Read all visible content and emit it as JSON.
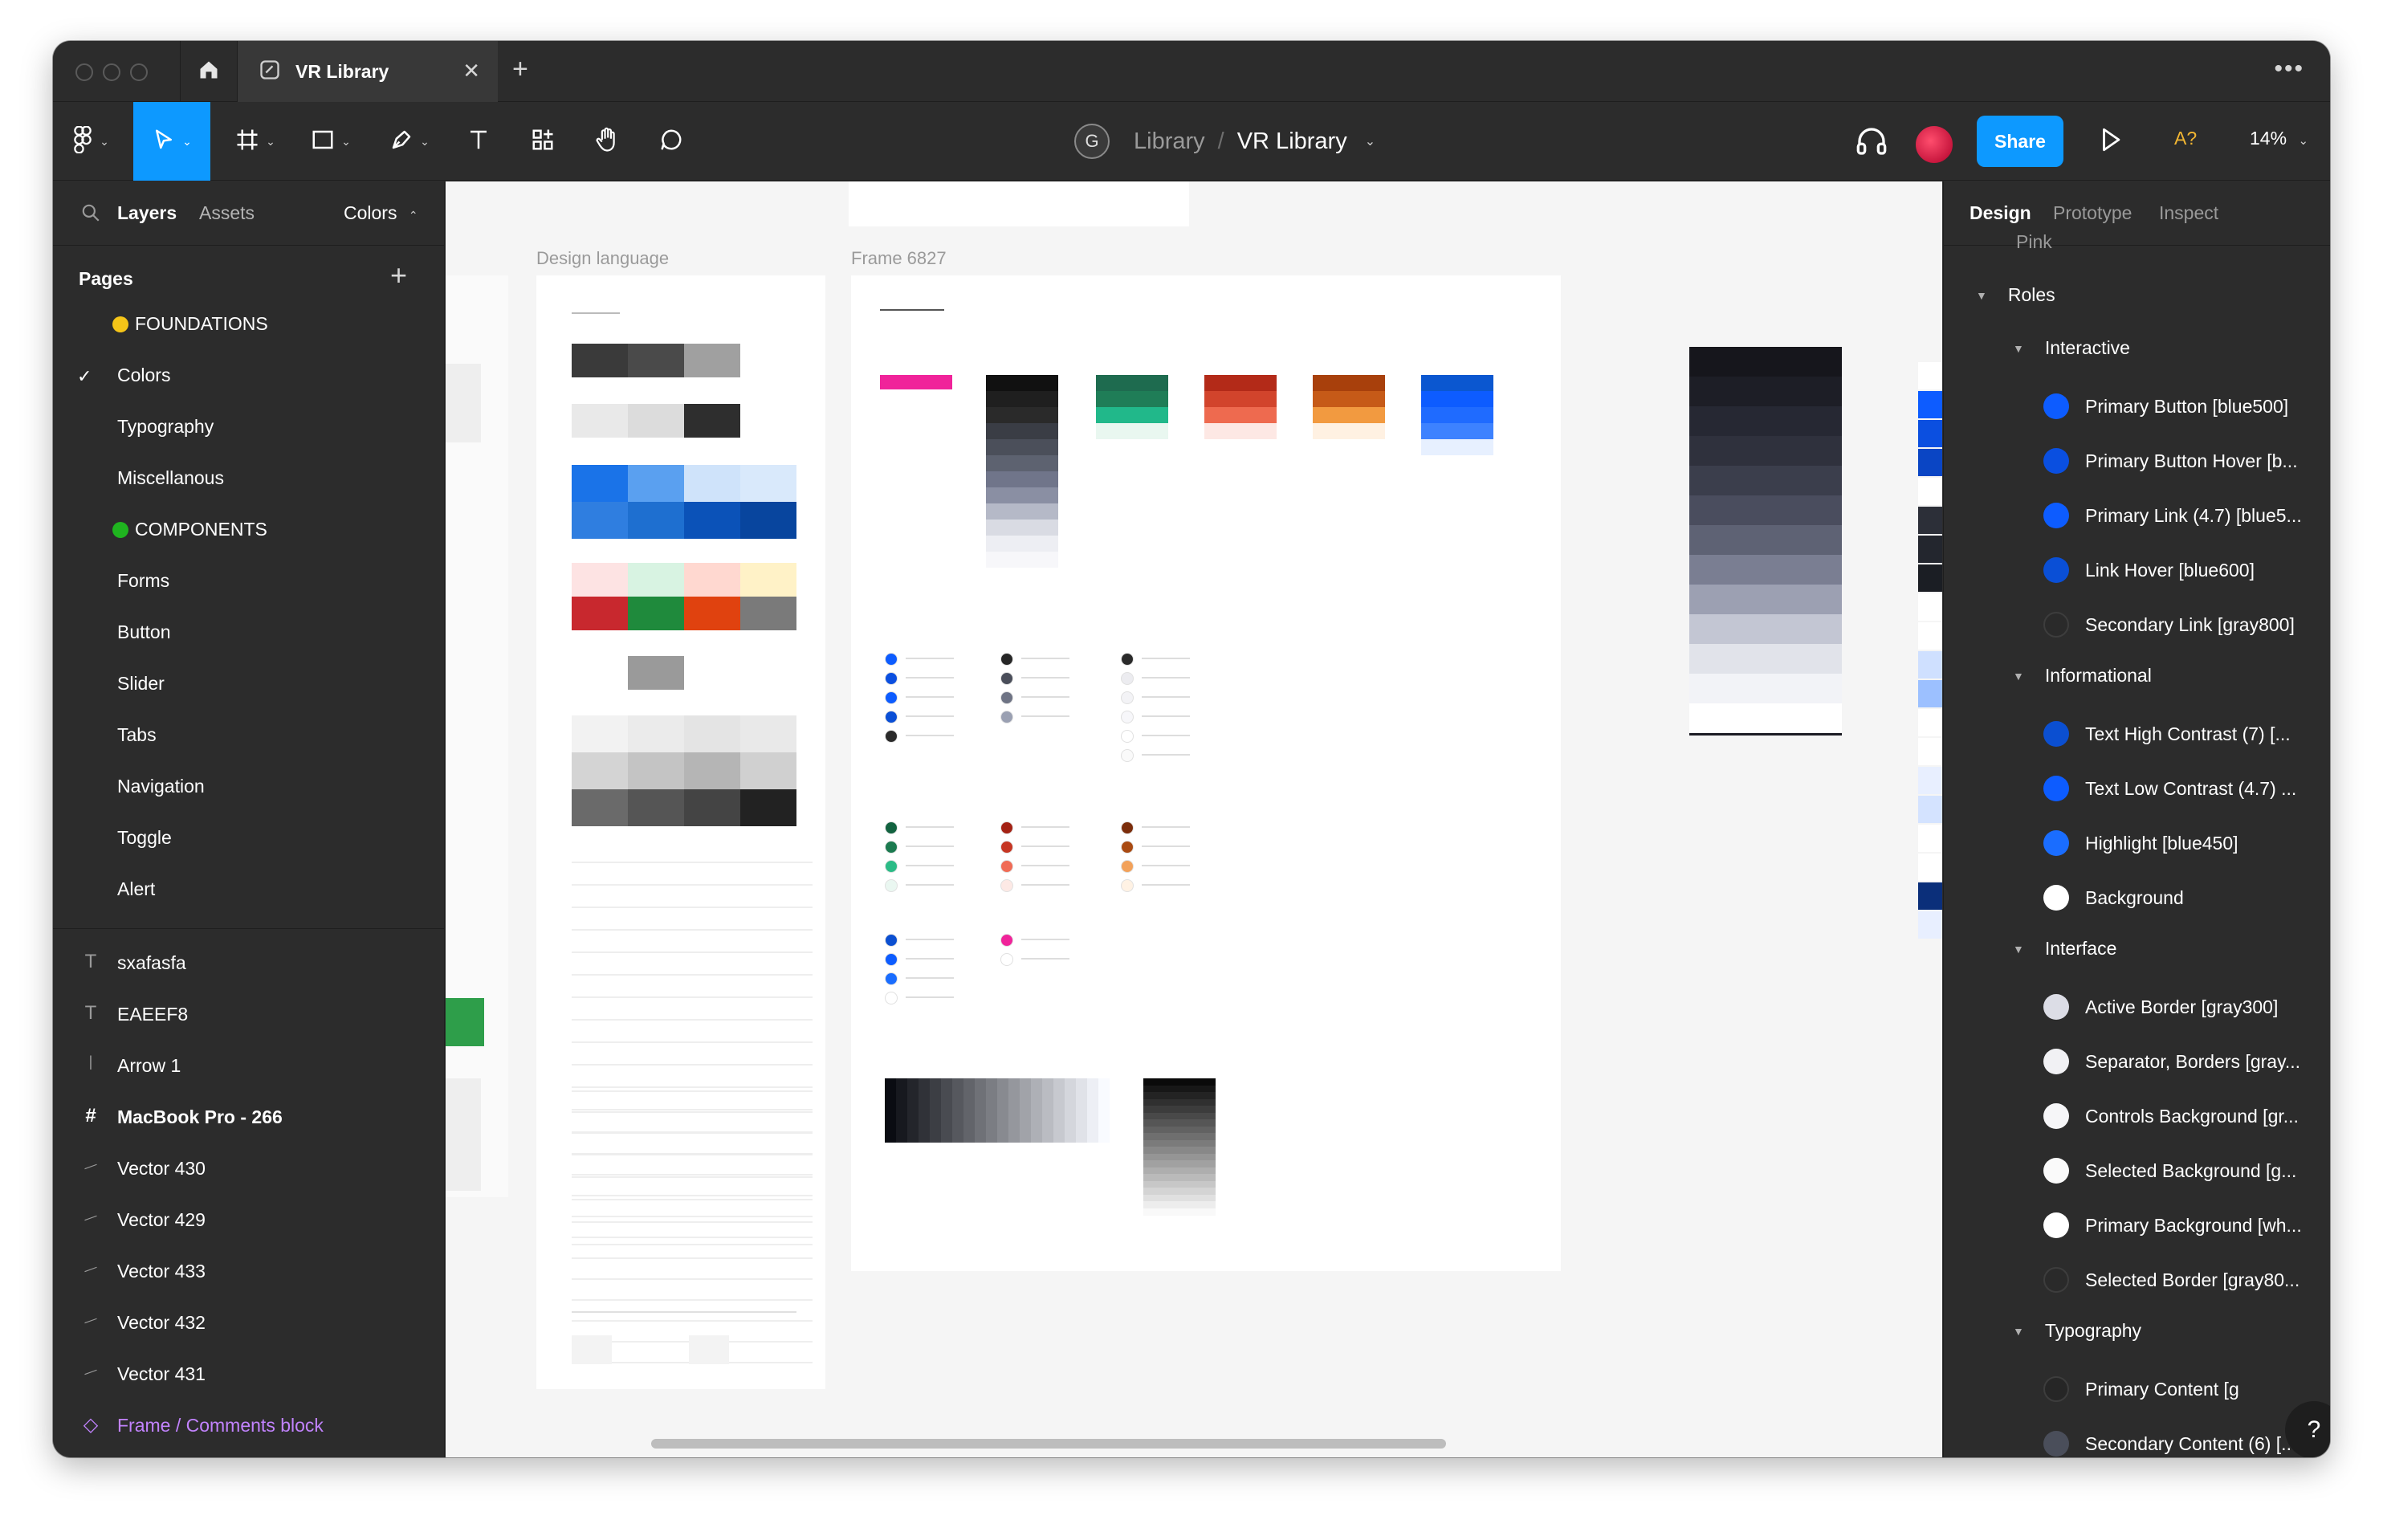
{
  "window": {
    "tab_title": "VR Library",
    "new_tab": "+",
    "close": "✕",
    "more": "•••"
  },
  "toolbar": {
    "user_initial": "G",
    "breadcrumb_project": "Library",
    "breadcrumb_sep": "/",
    "breadcrumb_file": "VR Library",
    "share_label": "Share",
    "a11y_label": "A?",
    "zoom": "14%"
  },
  "left_panel": {
    "tabs": [
      "Layers",
      "Assets"
    ],
    "page_selector": "Colors",
    "pages_header": "Pages",
    "pages": [
      {
        "label": "FOUNDATIONS",
        "dot": "#f5c518"
      },
      {
        "label": "Colors",
        "selected": true
      },
      {
        "label": "Typography"
      },
      {
        "label": "Miscellanous"
      },
      {
        "label": "COMPONENTS",
        "dot": "#1fb41f"
      },
      {
        "label": "Forms"
      },
      {
        "label": "Button"
      },
      {
        "label": "Slider"
      },
      {
        "label": "Tabs"
      },
      {
        "label": "Navigation"
      },
      {
        "label": "Toggle"
      },
      {
        "label": "Alert"
      }
    ],
    "layers": [
      {
        "label": "sxafasfa",
        "icon": "text-icon"
      },
      {
        "label": "EAEEF8",
        "icon": "text-icon"
      },
      {
        "label": "Arrow 1",
        "icon": "arrow-icon"
      },
      {
        "label": "MacBook Pro - 266",
        "icon": "frame-icon",
        "bold": true
      },
      {
        "label": "Vector 430",
        "icon": "vector-icon"
      },
      {
        "label": "Vector 429",
        "icon": "vector-icon"
      },
      {
        "label": "Vector 433",
        "icon": "vector-icon"
      },
      {
        "label": "Vector 432",
        "icon": "vector-icon"
      },
      {
        "label": "Vector 431",
        "icon": "vector-icon"
      },
      {
        "label": "Frame / Comments block",
        "icon": "component-icon",
        "accent": "#c283ff"
      }
    ]
  },
  "canvas": {
    "frame_labels": [
      "Design language",
      "Frame 6827"
    ]
  },
  "right_panel": {
    "tabs": [
      "Design",
      "Prototype",
      "Inspect"
    ],
    "truncated_top": "Pink",
    "roles_header": "Roles",
    "groups": [
      {
        "label": "Interactive",
        "items": [
          {
            "label": "Primary Button [blue500]",
            "color": "#0d5cff"
          },
          {
            "label": "Primary Button Hover [b...",
            "color": "#0a4fe0"
          },
          {
            "label": "Primary Link (4.7) [blue5...",
            "color": "#0d5cff"
          },
          {
            "label": "Link Hover [blue600]",
            "color": "#0a4fd6"
          },
          {
            "label": "Secondary Link [gray800]",
            "color": "#2a2a2a"
          }
        ]
      },
      {
        "label": "Informational",
        "items": [
          {
            "label": "Text High Contrast (7) [...",
            "color": "#0b4fd1"
          },
          {
            "label": "Text Low Contrast (4.7) ...",
            "color": "#0d5cff"
          },
          {
            "label": "Highlight [blue450]",
            "color": "#1a6dff"
          },
          {
            "label": "Background",
            "color": "#ffffff"
          }
        ]
      },
      {
        "label": "Interface",
        "items": [
          {
            "label": "Active Border [gray300]",
            "color": "#dcdde6"
          },
          {
            "label": "Separator, Borders [gray...",
            "color": "#f1f1f4"
          },
          {
            "label": "Controls Background [gr...",
            "color": "#f6f6f8"
          },
          {
            "label": "Selected Background [g...",
            "color": "#fafafa"
          },
          {
            "label": "Primary Background [wh...",
            "color": "#ffffff"
          },
          {
            "label": "Selected Border [gray80...",
            "color": "#2a2a2a"
          }
        ]
      },
      {
        "label": "Typography",
        "items": [
          {
            "label": "Primary Content [g",
            "color": "#262626"
          },
          {
            "label": "Secondary Content (6) [...",
            "color": "#4a4e5a"
          }
        ]
      }
    ],
    "help": "?"
  }
}
